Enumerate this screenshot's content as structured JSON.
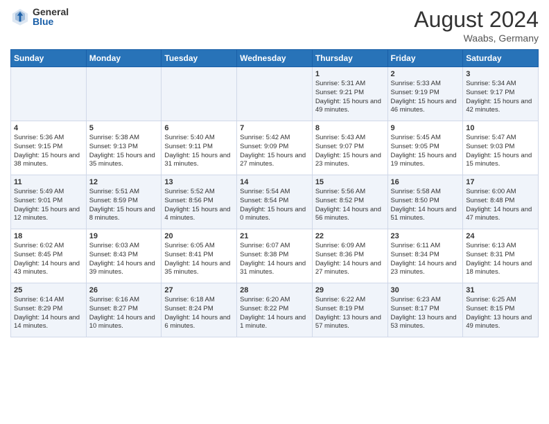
{
  "logo": {
    "general": "General",
    "blue": "Blue"
  },
  "header": {
    "month_year": "August 2024",
    "location": "Waabs, Germany"
  },
  "days_of_week": [
    "Sunday",
    "Monday",
    "Tuesday",
    "Wednesday",
    "Thursday",
    "Friday",
    "Saturday"
  ],
  "weeks": [
    [
      {
        "day": "",
        "info": ""
      },
      {
        "day": "",
        "info": ""
      },
      {
        "day": "",
        "info": ""
      },
      {
        "day": "",
        "info": ""
      },
      {
        "day": "1",
        "info": "Sunrise: 5:31 AM\nSunset: 9:21 PM\nDaylight: 15 hours and 49 minutes."
      },
      {
        "day": "2",
        "info": "Sunrise: 5:33 AM\nSunset: 9:19 PM\nDaylight: 15 hours and 46 minutes."
      },
      {
        "day": "3",
        "info": "Sunrise: 5:34 AM\nSunset: 9:17 PM\nDaylight: 15 hours and 42 minutes."
      }
    ],
    [
      {
        "day": "4",
        "info": "Sunrise: 5:36 AM\nSunset: 9:15 PM\nDaylight: 15 hours and 38 minutes."
      },
      {
        "day": "5",
        "info": "Sunrise: 5:38 AM\nSunset: 9:13 PM\nDaylight: 15 hours and 35 minutes."
      },
      {
        "day": "6",
        "info": "Sunrise: 5:40 AM\nSunset: 9:11 PM\nDaylight: 15 hours and 31 minutes."
      },
      {
        "day": "7",
        "info": "Sunrise: 5:42 AM\nSunset: 9:09 PM\nDaylight: 15 hours and 27 minutes."
      },
      {
        "day": "8",
        "info": "Sunrise: 5:43 AM\nSunset: 9:07 PM\nDaylight: 15 hours and 23 minutes."
      },
      {
        "day": "9",
        "info": "Sunrise: 5:45 AM\nSunset: 9:05 PM\nDaylight: 15 hours and 19 minutes."
      },
      {
        "day": "10",
        "info": "Sunrise: 5:47 AM\nSunset: 9:03 PM\nDaylight: 15 hours and 15 minutes."
      }
    ],
    [
      {
        "day": "11",
        "info": "Sunrise: 5:49 AM\nSunset: 9:01 PM\nDaylight: 15 hours and 12 minutes."
      },
      {
        "day": "12",
        "info": "Sunrise: 5:51 AM\nSunset: 8:59 PM\nDaylight: 15 hours and 8 minutes."
      },
      {
        "day": "13",
        "info": "Sunrise: 5:52 AM\nSunset: 8:56 PM\nDaylight: 15 hours and 4 minutes."
      },
      {
        "day": "14",
        "info": "Sunrise: 5:54 AM\nSunset: 8:54 PM\nDaylight: 15 hours and 0 minutes."
      },
      {
        "day": "15",
        "info": "Sunrise: 5:56 AM\nSunset: 8:52 PM\nDaylight: 14 hours and 56 minutes."
      },
      {
        "day": "16",
        "info": "Sunrise: 5:58 AM\nSunset: 8:50 PM\nDaylight: 14 hours and 51 minutes."
      },
      {
        "day": "17",
        "info": "Sunrise: 6:00 AM\nSunset: 8:48 PM\nDaylight: 14 hours and 47 minutes."
      }
    ],
    [
      {
        "day": "18",
        "info": "Sunrise: 6:02 AM\nSunset: 8:45 PM\nDaylight: 14 hours and 43 minutes."
      },
      {
        "day": "19",
        "info": "Sunrise: 6:03 AM\nSunset: 8:43 PM\nDaylight: 14 hours and 39 minutes."
      },
      {
        "day": "20",
        "info": "Sunrise: 6:05 AM\nSunset: 8:41 PM\nDaylight: 14 hours and 35 minutes."
      },
      {
        "day": "21",
        "info": "Sunrise: 6:07 AM\nSunset: 8:38 PM\nDaylight: 14 hours and 31 minutes."
      },
      {
        "day": "22",
        "info": "Sunrise: 6:09 AM\nSunset: 8:36 PM\nDaylight: 14 hours and 27 minutes."
      },
      {
        "day": "23",
        "info": "Sunrise: 6:11 AM\nSunset: 8:34 PM\nDaylight: 14 hours and 23 minutes."
      },
      {
        "day": "24",
        "info": "Sunrise: 6:13 AM\nSunset: 8:31 PM\nDaylight: 14 hours and 18 minutes."
      }
    ],
    [
      {
        "day": "25",
        "info": "Sunrise: 6:14 AM\nSunset: 8:29 PM\nDaylight: 14 hours and 14 minutes."
      },
      {
        "day": "26",
        "info": "Sunrise: 6:16 AM\nSunset: 8:27 PM\nDaylight: 14 hours and 10 minutes."
      },
      {
        "day": "27",
        "info": "Sunrise: 6:18 AM\nSunset: 8:24 PM\nDaylight: 14 hours and 6 minutes."
      },
      {
        "day": "28",
        "info": "Sunrise: 6:20 AM\nSunset: 8:22 PM\nDaylight: 14 hours and 1 minute."
      },
      {
        "day": "29",
        "info": "Sunrise: 6:22 AM\nSunset: 8:19 PM\nDaylight: 13 hours and 57 minutes."
      },
      {
        "day": "30",
        "info": "Sunrise: 6:23 AM\nSunset: 8:17 PM\nDaylight: 13 hours and 53 minutes."
      },
      {
        "day": "31",
        "info": "Sunrise: 6:25 AM\nSunset: 8:15 PM\nDaylight: 13 hours and 49 minutes."
      }
    ]
  ]
}
